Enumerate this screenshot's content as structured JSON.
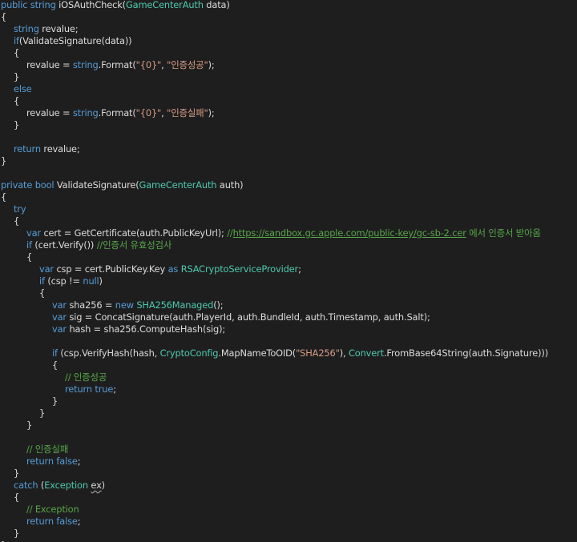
{
  "editor": {
    "colors": {
      "background": "#1e1e1e",
      "keyword": "#569cd6",
      "type": "#4ec9b0",
      "string": "#d69d85",
      "comment": "#57a64a",
      "plain": "#dcdcdc"
    },
    "lines": [
      {
        "indent": 0,
        "tokens": [
          {
            "t": "public",
            "k": "kw"
          },
          {
            "t": " "
          },
          {
            "t": "string",
            "k": "kw"
          },
          {
            "t": " iOSAuthCheck("
          },
          {
            "t": "GameCenterAuth",
            "k": "type"
          },
          {
            "t": " data)"
          }
        ]
      },
      {
        "indent": 0,
        "tokens": [
          {
            "t": "{"
          }
        ]
      },
      {
        "indent": 1,
        "tokens": [
          {
            "t": "string",
            "k": "kw"
          },
          {
            "t": " revalue;"
          }
        ]
      },
      {
        "indent": 1,
        "tokens": [
          {
            "t": "if",
            "k": "kw"
          },
          {
            "t": "(ValidateSignature(data))"
          }
        ]
      },
      {
        "indent": 1,
        "tokens": [
          {
            "t": "{"
          }
        ]
      },
      {
        "indent": 2,
        "tokens": [
          {
            "t": "revalue = "
          },
          {
            "t": "string",
            "k": "kw"
          },
          {
            "t": ".Format("
          },
          {
            "t": "\"{0}\"",
            "k": "str"
          },
          {
            "t": ", "
          },
          {
            "t": "\"인증성공\"",
            "k": "str"
          },
          {
            "t": ");"
          }
        ]
      },
      {
        "indent": 1,
        "tokens": [
          {
            "t": "}"
          }
        ]
      },
      {
        "indent": 1,
        "tokens": [
          {
            "t": "else",
            "k": "kw"
          }
        ]
      },
      {
        "indent": 1,
        "tokens": [
          {
            "t": "{"
          }
        ]
      },
      {
        "indent": 2,
        "tokens": [
          {
            "t": "revalue = "
          },
          {
            "t": "string",
            "k": "kw"
          },
          {
            "t": ".Format("
          },
          {
            "t": "\"{0}\"",
            "k": "str"
          },
          {
            "t": ", "
          },
          {
            "t": "\"인증실패\"",
            "k": "str"
          },
          {
            "t": ");"
          }
        ]
      },
      {
        "indent": 1,
        "tokens": [
          {
            "t": "}"
          }
        ]
      },
      {
        "indent": 0,
        "tokens": []
      },
      {
        "indent": 1,
        "tokens": [
          {
            "t": "return",
            "k": "kw"
          },
          {
            "t": " revalue;"
          }
        ]
      },
      {
        "indent": 0,
        "tokens": [
          {
            "t": "}"
          }
        ]
      },
      {
        "indent": 0,
        "tokens": []
      },
      {
        "indent": 0,
        "tokens": [
          {
            "t": "private",
            "k": "kw"
          },
          {
            "t": " "
          },
          {
            "t": "bool",
            "k": "kw"
          },
          {
            "t": " ValidateSignature("
          },
          {
            "t": "GameCenterAuth",
            "k": "type"
          },
          {
            "t": " auth)"
          }
        ]
      },
      {
        "indent": 0,
        "tokens": [
          {
            "t": "{"
          }
        ]
      },
      {
        "indent": 1,
        "tokens": [
          {
            "t": "try",
            "k": "kw"
          }
        ]
      },
      {
        "indent": 1,
        "tokens": [
          {
            "t": "{"
          }
        ]
      },
      {
        "indent": 2,
        "tokens": [
          {
            "t": "var",
            "k": "kw"
          },
          {
            "t": " cert = GetCertificate(auth.PublicKeyUrl); "
          },
          {
            "t": "//",
            "k": "cm"
          },
          {
            "t": "https://sandbox.gc.apple.com/public-key/gc-sb-2.cer",
            "k": "url"
          },
          {
            "t": " 에서 인증서 받아옴",
            "k": "cm"
          }
        ]
      },
      {
        "indent": 2,
        "tokens": [
          {
            "t": "if",
            "k": "kw"
          },
          {
            "t": " (cert.Verify()) "
          },
          {
            "t": "//인증서 유효성검사",
            "k": "cm"
          }
        ]
      },
      {
        "indent": 2,
        "tokens": [
          {
            "t": "{"
          }
        ]
      },
      {
        "indent": 3,
        "tokens": [
          {
            "t": "var",
            "k": "kw"
          },
          {
            "t": " csp = cert.PublicKey.Key "
          },
          {
            "t": "as",
            "k": "kw"
          },
          {
            "t": " "
          },
          {
            "t": "RSACryptoServiceProvider",
            "k": "type"
          },
          {
            "t": ";"
          }
        ]
      },
      {
        "indent": 3,
        "tokens": [
          {
            "t": "if",
            "k": "kw"
          },
          {
            "t": " (csp != "
          },
          {
            "t": "null",
            "k": "kw"
          },
          {
            "t": ")"
          }
        ]
      },
      {
        "indent": 3,
        "tokens": [
          {
            "t": "{"
          }
        ]
      },
      {
        "indent": 4,
        "tokens": [
          {
            "t": "var",
            "k": "kw"
          },
          {
            "t": " sha256 = "
          },
          {
            "t": "new",
            "k": "kw"
          },
          {
            "t": " "
          },
          {
            "t": "SHA256Managed",
            "k": "type"
          },
          {
            "t": "();"
          }
        ]
      },
      {
        "indent": 4,
        "tokens": [
          {
            "t": "var",
            "k": "kw"
          },
          {
            "t": " sig = ConcatSignature(auth.PlayerId, auth.BundleId, auth.Timestamp, auth.Salt);"
          }
        ]
      },
      {
        "indent": 4,
        "tokens": [
          {
            "t": "var",
            "k": "kw"
          },
          {
            "t": " hash = sha256.ComputeHash(sig);"
          }
        ]
      },
      {
        "indent": 0,
        "tokens": []
      },
      {
        "indent": 4,
        "tokens": [
          {
            "t": "if",
            "k": "kw"
          },
          {
            "t": " (csp.VerifyHash(hash, "
          },
          {
            "t": "CryptoConfig",
            "k": "type"
          },
          {
            "t": ".MapNameToOID("
          },
          {
            "t": "\"SHA256\"",
            "k": "str"
          },
          {
            "t": "), "
          },
          {
            "t": "Convert",
            "k": "type"
          },
          {
            "t": ".FromBase64String(auth.Signature)))"
          }
        ]
      },
      {
        "indent": 4,
        "tokens": [
          {
            "t": "{"
          }
        ]
      },
      {
        "indent": 5,
        "tokens": [
          {
            "t": "// 인증성공",
            "k": "cm"
          }
        ]
      },
      {
        "indent": 5,
        "tokens": [
          {
            "t": "return",
            "k": "kw"
          },
          {
            "t": " "
          },
          {
            "t": "true",
            "k": "kw"
          },
          {
            "t": ";"
          }
        ]
      },
      {
        "indent": 4,
        "tokens": [
          {
            "t": "}"
          }
        ]
      },
      {
        "indent": 3,
        "tokens": [
          {
            "t": "}"
          }
        ]
      },
      {
        "indent": 2,
        "tokens": [
          {
            "t": "}"
          }
        ]
      },
      {
        "indent": 0,
        "tokens": []
      },
      {
        "indent": 2,
        "tokens": [
          {
            "t": "// 인증실패",
            "k": "cm"
          }
        ]
      },
      {
        "indent": 2,
        "tokens": [
          {
            "t": "return",
            "k": "kw"
          },
          {
            "t": " "
          },
          {
            "t": "false",
            "k": "kw"
          },
          {
            "t": ";"
          }
        ]
      },
      {
        "indent": 1,
        "tokens": [
          {
            "t": "}"
          }
        ]
      },
      {
        "indent": 1,
        "tokens": [
          {
            "t": "catch",
            "k": "kw"
          },
          {
            "t": " ("
          },
          {
            "t": "Exception",
            "k": "type"
          },
          {
            "t": " "
          },
          {
            "t": "ex",
            "k": "squig"
          },
          {
            "t": ")"
          }
        ]
      },
      {
        "indent": 1,
        "tokens": [
          {
            "t": "{"
          }
        ]
      },
      {
        "indent": 2,
        "tokens": [
          {
            "t": "// Exception",
            "k": "cm"
          }
        ]
      },
      {
        "indent": 2,
        "tokens": [
          {
            "t": "return",
            "k": "kw"
          },
          {
            "t": " "
          },
          {
            "t": "false",
            "k": "kw"
          },
          {
            "t": ";"
          }
        ]
      },
      {
        "indent": 1,
        "tokens": [
          {
            "t": "}"
          }
        ]
      },
      {
        "indent": 0,
        "tokens": [
          {
            "t": "}"
          }
        ]
      }
    ]
  }
}
